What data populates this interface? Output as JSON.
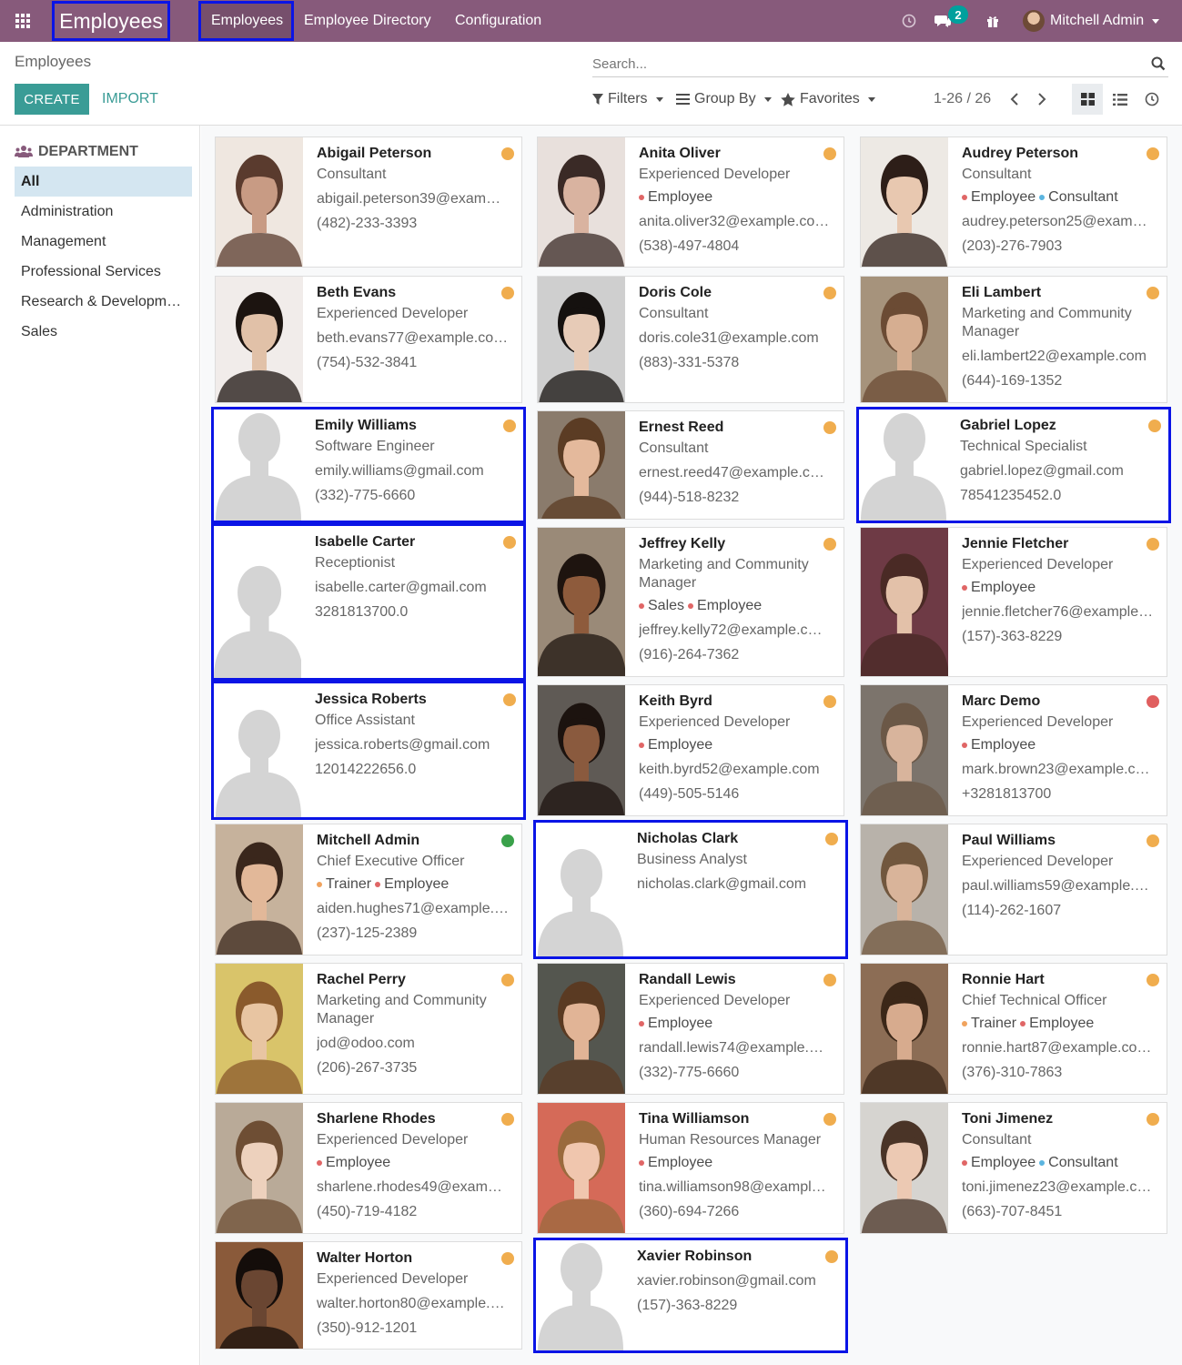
{
  "navbar": {
    "brand": "Employees",
    "menu": [
      "Employees",
      "Employee Directory",
      "Configuration"
    ],
    "messages_badge": "2",
    "user_name": "Mitchell Admin"
  },
  "control_panel": {
    "breadcrumb": "Employees",
    "search_placeholder": "Search...",
    "create_label": "CREATE",
    "import_label": "IMPORT",
    "filters_label": "Filters",
    "groupby_label": "Group By",
    "favorites_label": "Favorites",
    "pager": "1-26 / 26"
  },
  "sidebar": {
    "title": "DEPARTMENT",
    "items": [
      "All",
      "Administration",
      "Management",
      "Professional Services",
      "Research & Developm…",
      "Sales"
    ]
  },
  "tag_colors": {
    "Employee": "#e06666",
    "Consultant": "#5bb5e0",
    "Sales": "#e06666",
    "Trainer": "#f0a35e"
  },
  "status_colors": {
    "orange": "#f0ad4e",
    "red": "#e05f5f",
    "green": "#3aa14a"
  },
  "employees": [
    {
      "name": "Abigail Peterson",
      "job": "Consultant",
      "tags": [],
      "email": "abigail.peterson39@exam…",
      "phone": "(482)-233-3393",
      "status": "orange",
      "photo": "photo"
    },
    {
      "name": "Anita Oliver",
      "job": "Experienced Developer",
      "tags": [
        "Employee"
      ],
      "email": "anita.oliver32@example.co…",
      "phone": "(538)-497-4804",
      "status": "orange",
      "photo": "photo"
    },
    {
      "name": "Audrey Peterson",
      "job": "Consultant",
      "tags": [
        "Employee",
        "Consultant"
      ],
      "email": "audrey.peterson25@exam…",
      "phone": "(203)-276-7903",
      "status": "orange",
      "photo": "photo"
    },
    {
      "name": "Beth Evans",
      "job": "Experienced Developer",
      "tags": [],
      "email": "beth.evans77@example.co…",
      "phone": "(754)-532-3841",
      "status": "orange",
      "photo": "photo"
    },
    {
      "name": "Doris Cole",
      "job": "Consultant",
      "tags": [],
      "email": "doris.cole31@example.com",
      "phone": "(883)-331-5378",
      "status": "orange",
      "photo": "photo"
    },
    {
      "name": "Eli Lambert",
      "job": "Marketing and Community Manager",
      "tags": [],
      "email": "eli.lambert22@example.com",
      "phone": "(644)-169-1352",
      "status": "orange",
      "photo": "photo"
    },
    {
      "name": "Emily Williams",
      "job": "Software Engineer",
      "tags": [],
      "email": "emily.williams@gmail.com",
      "phone": "(332)-775-6660",
      "status": "orange",
      "photo": "placeholder"
    },
    {
      "name": "Ernest Reed",
      "job": "Consultant",
      "tags": [],
      "email": "ernest.reed47@example.c…",
      "phone": "(944)-518-8232",
      "status": "orange",
      "photo": "photo"
    },
    {
      "name": "Gabriel Lopez",
      "job": "Technical Specialist",
      "tags": [],
      "email": "gabriel.lopez@gmail.com",
      "phone": "78541235452.0",
      "status": "orange",
      "photo": "placeholder"
    },
    {
      "name": "Isabelle Carter",
      "job": "Receptionist",
      "tags": [],
      "email": "isabelle.carter@gmail.com",
      "phone": "3281813700.0",
      "status": "orange",
      "photo": "placeholder"
    },
    {
      "name": "Jeffrey Kelly",
      "job": "Marketing and Community Manager",
      "tags": [
        "Sales",
        "Employee"
      ],
      "email": "jeffrey.kelly72@example.c…",
      "phone": "(916)-264-7362",
      "status": "orange",
      "photo": "photo"
    },
    {
      "name": "Jennie Fletcher",
      "job": "Experienced Developer",
      "tags": [
        "Employee"
      ],
      "email": "jennie.fletcher76@example…",
      "phone": "(157)-363-8229",
      "status": "orange",
      "photo": "photo"
    },
    {
      "name": "Jessica Roberts",
      "job": "Office Assistant",
      "tags": [],
      "email": "jessica.roberts@gmail.com",
      "phone": "12014222656.0",
      "status": "orange",
      "photo": "placeholder"
    },
    {
      "name": "Keith Byrd",
      "job": "Experienced Developer",
      "tags": [
        "Employee"
      ],
      "email": "keith.byrd52@example.com",
      "phone": "(449)-505-5146",
      "status": "orange",
      "photo": "photo"
    },
    {
      "name": "Marc Demo",
      "job": "Experienced Developer",
      "tags": [
        "Employee"
      ],
      "email": "mark.brown23@example.c…",
      "phone": "+3281813700",
      "status": "red",
      "photo": "photo"
    },
    {
      "name": "Mitchell Admin",
      "job": "Chief Executive Officer",
      "tags": [
        "Trainer",
        "Employee"
      ],
      "email": "aiden.hughes71@example.…",
      "phone": "(237)-125-2389",
      "status": "green",
      "photo": "photo"
    },
    {
      "name": "Nicholas Clark",
      "job": "Business Analyst",
      "tags": [],
      "email": "nicholas.clark@gmail.com",
      "phone": "",
      "status": "orange",
      "photo": "placeholder"
    },
    {
      "name": "Paul Williams",
      "job": "Experienced Developer",
      "tags": [],
      "email": "paul.williams59@example.…",
      "phone": "(114)-262-1607",
      "status": "orange",
      "photo": "photo"
    },
    {
      "name": "Rachel Perry",
      "job": "Marketing and Community Manager",
      "tags": [],
      "email": "jod@odoo.com",
      "phone": "(206)-267-3735",
      "status": "orange",
      "photo": "photo"
    },
    {
      "name": "Randall Lewis",
      "job": "Experienced Developer",
      "tags": [
        "Employee"
      ],
      "email": "randall.lewis74@example.…",
      "phone": "(332)-775-6660",
      "status": "orange",
      "photo": "photo"
    },
    {
      "name": "Ronnie Hart",
      "job": "Chief Technical Officer",
      "tags": [
        "Trainer",
        "Employee"
      ],
      "email": "ronnie.hart87@example.co…",
      "phone": "(376)-310-7863",
      "status": "orange",
      "photo": "photo"
    },
    {
      "name": "Sharlene Rhodes",
      "job": "Experienced Developer",
      "tags": [
        "Employee"
      ],
      "email": "sharlene.rhodes49@exam…",
      "phone": "(450)-719-4182",
      "status": "orange",
      "photo": "photo"
    },
    {
      "name": "Tina Williamson",
      "job": "Human Resources Manager",
      "tags": [
        "Employee"
      ],
      "email": "tina.williamson98@exampl…",
      "phone": "(360)-694-7266",
      "status": "orange",
      "photo": "photo"
    },
    {
      "name": "Toni Jimenez",
      "job": "Consultant",
      "tags": [
        "Employee",
        "Consultant"
      ],
      "email": "toni.jimenez23@example.c…",
      "phone": "(663)-707-8451",
      "status": "orange",
      "photo": "photo"
    },
    {
      "name": "Walter Horton",
      "job": "Experienced Developer",
      "tags": [],
      "email": "walter.horton80@example.…",
      "phone": "(350)-912-1201",
      "status": "orange",
      "photo": "photo"
    },
    {
      "name": "Xavier Robinson",
      "job": "",
      "tags": [],
      "email": "xavier.robinson@gmail.com",
      "phone": "(157)-363-8229",
      "status": "orange",
      "photo": "placeholder"
    }
  ]
}
